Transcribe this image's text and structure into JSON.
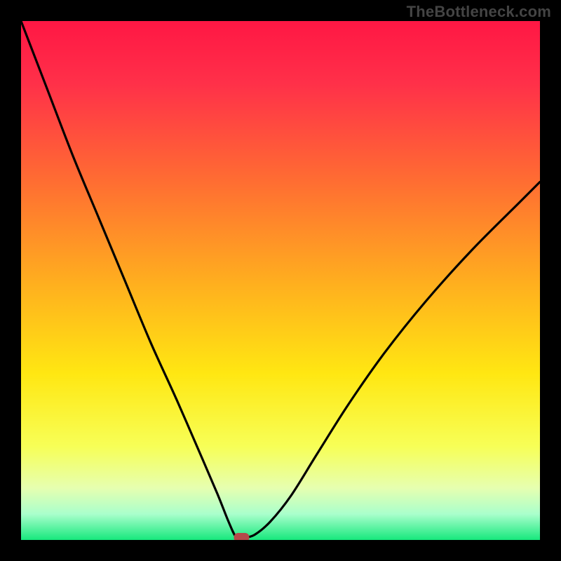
{
  "watermark": "TheBottleneck.com",
  "chart_data": {
    "type": "line",
    "title": "",
    "xlabel": "",
    "ylabel": "",
    "xlim": [
      0,
      1
    ],
    "ylim": [
      0,
      1
    ],
    "grid": false,
    "legend": false,
    "series": [
      {
        "name": "bottleneck-curve",
        "x": [
          0.0,
          0.05,
          0.1,
          0.15,
          0.2,
          0.25,
          0.3,
          0.35,
          0.38,
          0.4,
          0.415,
          0.43,
          0.45,
          0.48,
          0.52,
          0.57,
          0.63,
          0.7,
          0.78,
          0.87,
          0.96,
          1.0
        ],
        "y": [
          1.0,
          0.87,
          0.74,
          0.62,
          0.5,
          0.38,
          0.27,
          0.155,
          0.085,
          0.035,
          0.005,
          0.005,
          0.01,
          0.035,
          0.085,
          0.165,
          0.26,
          0.36,
          0.46,
          0.56,
          0.65,
          0.69
        ]
      }
    ],
    "marker": {
      "x": 0.425,
      "y": 0.0,
      "color": "#b54a4a"
    },
    "background": {
      "type": "vertical-gradient",
      "stops": [
        {
          "pos": 0.0,
          "color": "#ff1744"
        },
        {
          "pos": 0.12,
          "color": "#ff3049"
        },
        {
          "pos": 0.3,
          "color": "#ff6a33"
        },
        {
          "pos": 0.5,
          "color": "#ffad1f"
        },
        {
          "pos": 0.68,
          "color": "#ffe712"
        },
        {
          "pos": 0.82,
          "color": "#f7ff57"
        },
        {
          "pos": 0.9,
          "color": "#e6ffb0"
        },
        {
          "pos": 0.95,
          "color": "#aaffcc"
        },
        {
          "pos": 1.0,
          "color": "#17e87d"
        }
      ]
    }
  }
}
